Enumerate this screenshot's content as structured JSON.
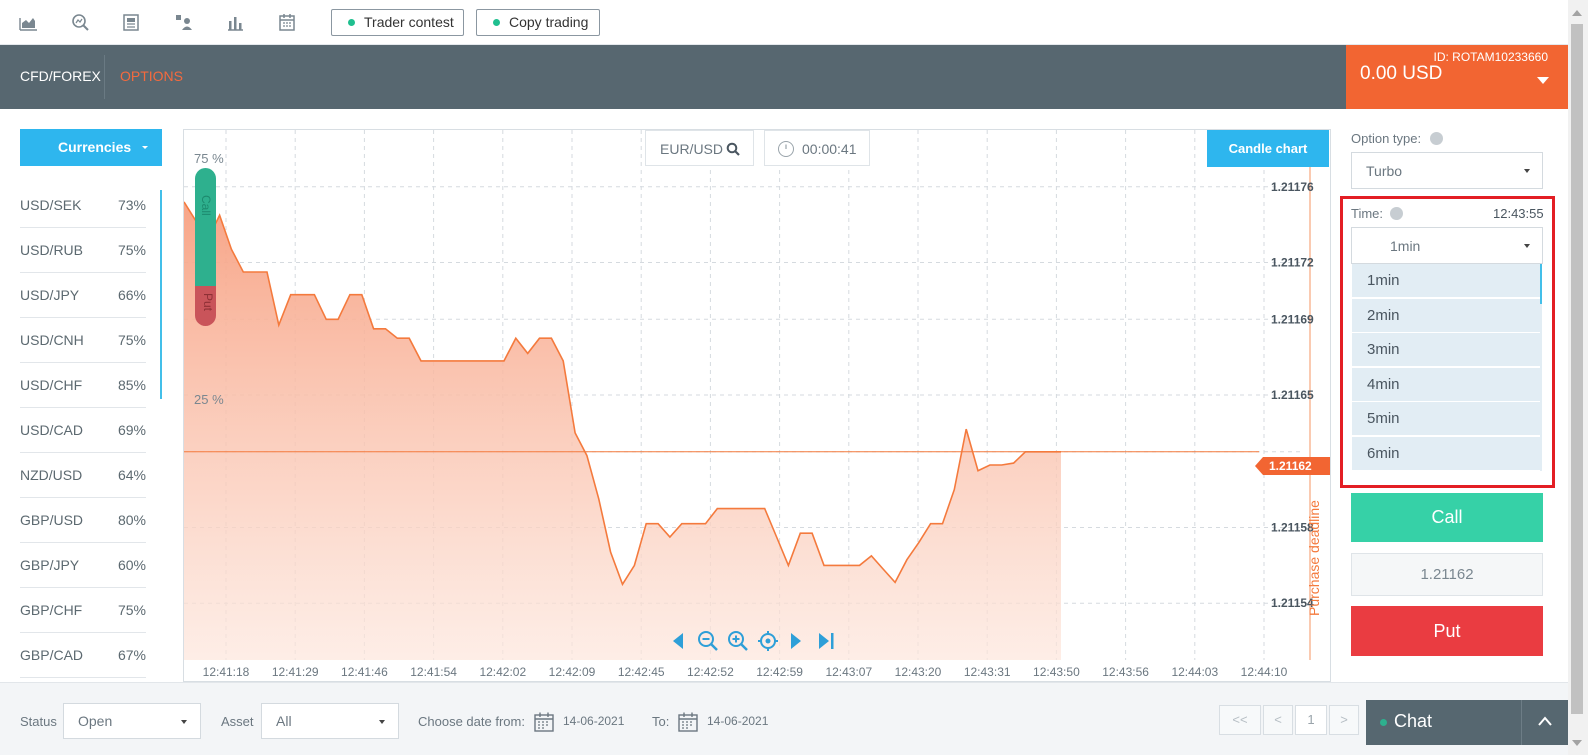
{
  "toolbar": {
    "icons": [
      "area-chart-icon",
      "search-chart-icon",
      "news-icon",
      "people-icon",
      "bar-chart-icon",
      "calendar-icon"
    ],
    "trader_contest": "Trader contest",
    "copy_trading": "Copy trading"
  },
  "header": {
    "tab_cfd": "CFD/FOREX",
    "tab_options": "OPTIONS",
    "account_id": "ID: ROTAM10233660",
    "balance": "0.00 USD"
  },
  "currencies": {
    "button_label": "Currencies",
    "items": [
      {
        "pair": "USD/SEK",
        "pct": "73%"
      },
      {
        "pair": "USD/RUB",
        "pct": "75%"
      },
      {
        "pair": "USD/JPY",
        "pct": "66%"
      },
      {
        "pair": "USD/CNH",
        "pct": "75%"
      },
      {
        "pair": "USD/CHF",
        "pct": "85%"
      },
      {
        "pair": "USD/CAD",
        "pct": "69%"
      },
      {
        "pair": "NZD/USD",
        "pct": "64%"
      },
      {
        "pair": "GBP/USD",
        "pct": "80%"
      },
      {
        "pair": "GBP/JPY",
        "pct": "60%"
      },
      {
        "pair": "GBP/CHF",
        "pct": "75%"
      },
      {
        "pair": "GBP/CAD",
        "pct": "67%"
      }
    ]
  },
  "chart": {
    "symbol": "EUR/USD",
    "timer": "00:00:41",
    "candle_button": "Candle chart",
    "call_pct": "75 %",
    "put_pct": "25 %",
    "call_label": "Call",
    "put_label": "Put",
    "deadline_label": "Purchase deadline",
    "current_price": "1.21162",
    "colors": {
      "line": "#f47a3d",
      "call": "#2eb08e",
      "put": "#d9534f",
      "accent": "#2eb6ee"
    }
  },
  "chart_data": {
    "type": "area",
    "x_ticks": [
      "12:41:18",
      "12:41:29",
      "12:41:46",
      "12:41:54",
      "12:42:02",
      "12:42:09",
      "12:42:45",
      "12:42:52",
      "12:42:59",
      "12:43:07",
      "12:43:20",
      "12:43:31",
      "12:43:50",
      "12:43:56",
      "12:44:03",
      "12:44:10"
    ],
    "y_ticks": [
      "1.21176",
      "1.21172",
      "1.21169",
      "1.21165",
      "1.21162",
      "1.21158",
      "1.21154"
    ],
    "ylim": [
      1.21151,
      1.21179
    ],
    "current": 1.21162,
    "x": [
      0,
      1,
      2,
      3,
      4,
      5,
      6,
      7,
      8,
      9,
      10,
      11,
      12,
      13,
      14,
      15,
      16,
      17,
      18,
      19,
      20,
      21,
      22,
      23,
      24,
      25,
      26,
      27,
      28,
      29,
      30,
      31,
      32,
      33,
      34,
      35,
      36,
      37,
      38,
      39,
      40,
      41,
      42,
      43,
      44,
      45,
      46,
      47,
      48,
      49,
      50,
      51,
      52,
      53,
      54,
      55,
      56,
      57,
      58,
      59,
      60,
      61,
      62,
      63,
      64,
      65,
      66,
      67,
      68,
      69,
      70,
      71,
      72,
      73,
      74
    ],
    "values": [
      1.211752,
      1.211742,
      1.211732,
      1.211745,
      1.211727,
      1.211715,
      1.211715,
      1.211715,
      1.211687,
      1.211703,
      1.211703,
      1.211703,
      1.21169,
      1.21169,
      1.211703,
      1.211703,
      1.211685,
      1.211685,
      1.21168,
      1.21168,
      1.211668,
      1.211668,
      1.211668,
      1.211668,
      1.211668,
      1.211668,
      1.211668,
      1.211668,
      1.21168,
      1.211672,
      1.21168,
      1.21168,
      1.211668,
      1.21163,
      1.211618,
      1.211595,
      1.211567,
      1.21155,
      1.21156,
      1.211582,
      1.211582,
      1.211575,
      1.211582,
      1.211582,
      1.211582,
      1.21159,
      1.21159,
      1.21159,
      1.21159,
      1.21159,
      1.211575,
      1.21156,
      1.211577,
      1.211577,
      1.21156,
      1.21156,
      1.21156,
      1.21156,
      1.211565,
      1.211558,
      1.211551,
      1.211563,
      1.211572,
      1.211582,
      1.211582,
      1.2116,
      1.211632,
      1.21161,
      1.211613,
      1.211613,
      1.211614,
      1.21162,
      1.21162,
      1.21162,
      1.21162
    ]
  },
  "right_panel": {
    "option_type_label": "Option type:",
    "option_type_value": "Turbo",
    "time_label": "Time:",
    "time_value": "12:43:55",
    "duration_selected": "1min",
    "duration_options": [
      "1min",
      "2min",
      "3min",
      "4min",
      "5min",
      "6min"
    ],
    "call_button": "Call",
    "price": "1.21162",
    "put_button": "Put"
  },
  "bottom": {
    "status_label": "Status",
    "status_value": "Open",
    "asset_label": "Asset",
    "asset_value": "All",
    "date_from_label": "Choose date from:",
    "date_from": "14-06-2021",
    "to_label": "To:",
    "date_to": "14-06-2021",
    "pager_first": "<<",
    "pager_prev": "<",
    "pager_page": "1",
    "pager_next": ">",
    "chat_label": "Chat"
  }
}
